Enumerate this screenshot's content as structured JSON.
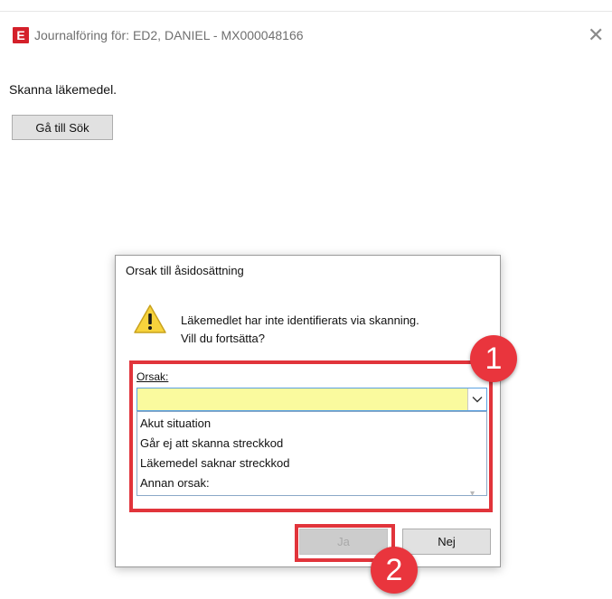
{
  "window": {
    "app_icon_letter": "E",
    "title": "Journalföring för: ED2, DANIEL - MX000048166",
    "close_glyph": "✕"
  },
  "main": {
    "scan_label": "Skanna läkemedel.",
    "goto_button": "Gå till Sök"
  },
  "dialog": {
    "title": "Orsak till åsidosättning",
    "icon": "warning-icon",
    "message_line1": "Läkemedlet har inte identifierats via skanning.",
    "message_line2": "Vill du fortsätta?",
    "reason_label": "Orsak:",
    "reason_value": "",
    "reason_options": [
      "Akut situation",
      "Går ej att skanna streckkod",
      "Läkemedel saknar streckkod",
      "Annan orsak:"
    ],
    "yes_button": "Ja",
    "no_button": "Nej"
  },
  "annotations": {
    "callout_1": "1",
    "callout_2": "2",
    "highlight_color": "#e1343b"
  },
  "colors": {
    "combo_background": "#fafa9e",
    "brand_red": "#d4202a"
  }
}
